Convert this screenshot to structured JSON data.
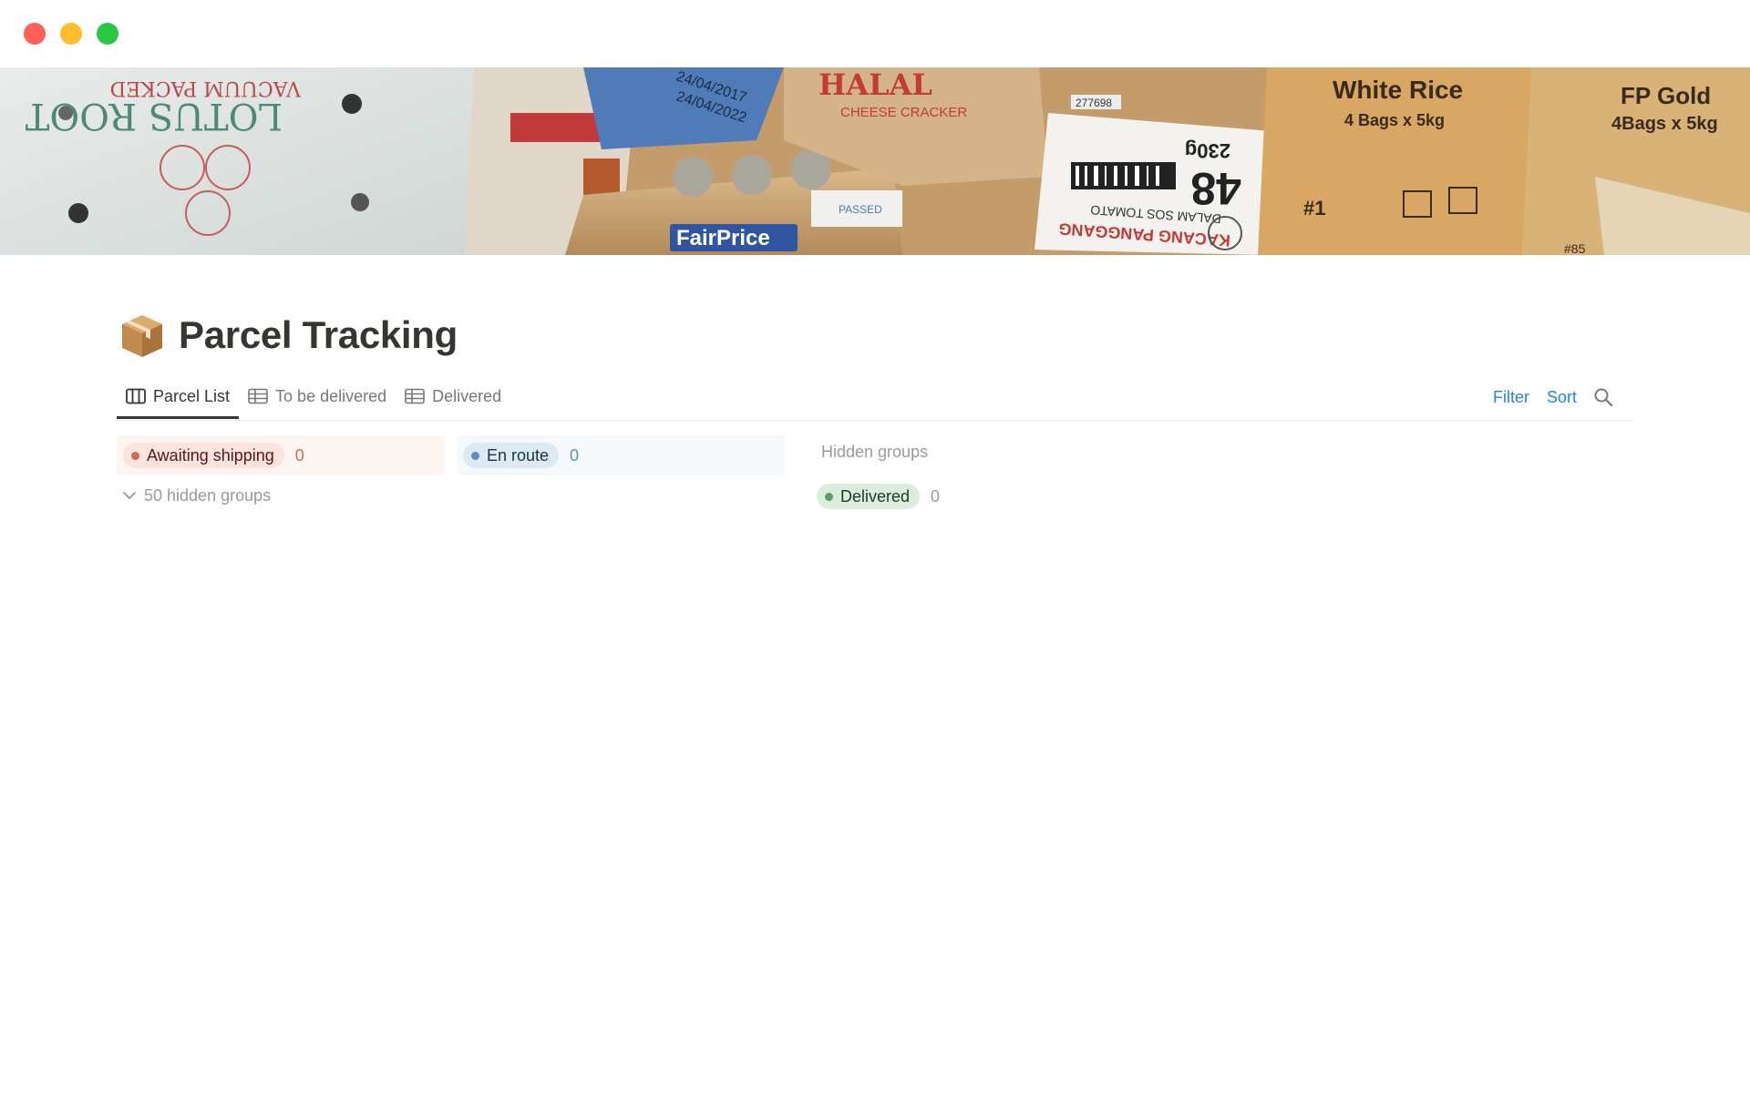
{
  "window": {
    "controls": [
      "close",
      "minimize",
      "zoom"
    ]
  },
  "cover": {
    "description_icon": "cardboard-boxes-cover",
    "box_texts": {
      "lotus": "LOTUS ROOT",
      "vacuum": "VACUUM PACKED",
      "halal": "HALAL",
      "cheese": "CHEESE CRACKER",
      "fairprice": "FairPrice",
      "passed": "PASSED",
      "num48": "48",
      "weight": "230g",
      "kacang": "KACANG PANGGANG",
      "dalam": "DALAM SOS TOMATO",
      "white_rice": "White Rice",
      "white_rice_sub": "4 Bags x 5kg",
      "fp_gold": "FP Gold",
      "fp_gold_sub": "4Bags x 5kg",
      "hash1": "#1",
      "hash85": "#85",
      "date1": "24/04/2017",
      "date2": "24/04/2022",
      "code": "277698"
    }
  },
  "page": {
    "icon": "package-icon",
    "title": "Parcel Tracking"
  },
  "tabs": [
    {
      "label": "Parcel List",
      "icon": "board-icon",
      "active": true
    },
    {
      "label": "To be delivered",
      "icon": "table-icon",
      "active": false
    },
    {
      "label": "Delivered",
      "icon": "table-icon",
      "active": false
    }
  ],
  "toolbar": {
    "filter_label": "Filter",
    "sort_label": "Sort",
    "search_icon": "search-icon"
  },
  "board": {
    "groups": [
      {
        "label": "Awaiting shipping",
        "count": "0",
        "color": "#d4665c"
      },
      {
        "label": "En route",
        "count": "0",
        "color": "#5b8fc4"
      }
    ],
    "hidden_groups_toggle": "50 hidden groups",
    "hidden_groups_header": "Hidden groups",
    "hidden_groups": [
      {
        "label": "Delivered",
        "count": "0",
        "color": "#5a9a6c"
      }
    ]
  }
}
